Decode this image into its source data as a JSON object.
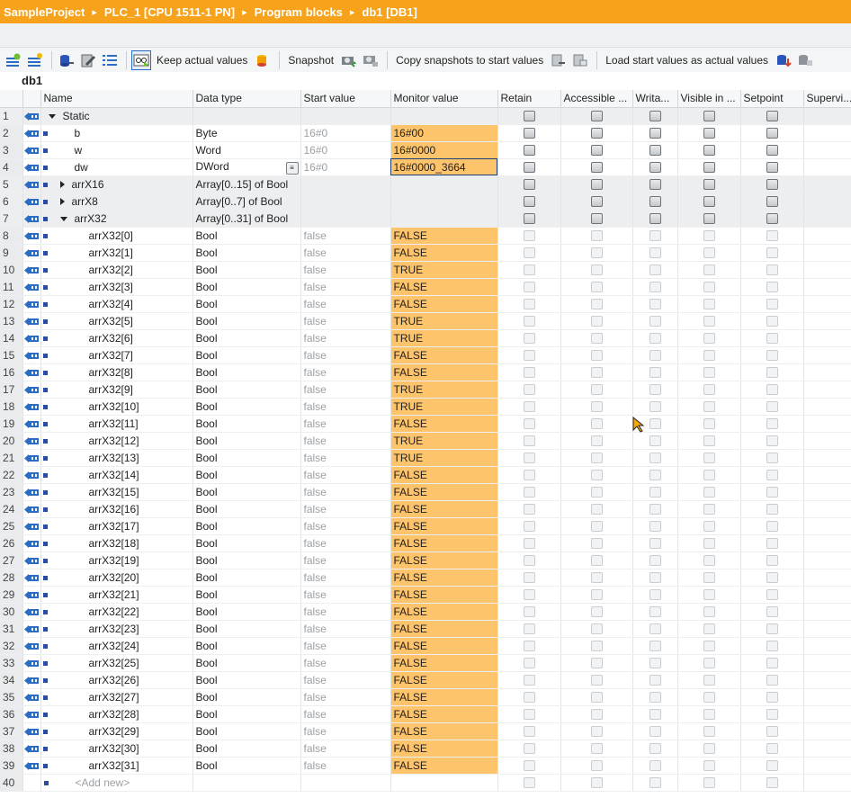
{
  "breadcrumb": [
    "SampleProject",
    "PLC_1 [CPU 1511-1 PN]",
    "Program blocks",
    "db1 [DB1]"
  ],
  "toolbar": {
    "keep_actual": "Keep actual values",
    "snapshot": "Snapshot",
    "copy_snapshots": "Copy snapshots to start values",
    "load_start": "Load start values as actual values"
  },
  "block_title": "db1",
  "columns": [
    "Name",
    "Data type",
    "Start value",
    "Monitor value",
    "Retain",
    "Accessible ...",
    "Writa...",
    "Visible in ...",
    "Setpoint",
    "Supervi..."
  ],
  "rows": [
    {
      "n": "1",
      "name": "Static",
      "type": "",
      "start": "",
      "mon": "",
      "level": 0,
      "exp": "down"
    },
    {
      "n": "2",
      "name": "b",
      "type": "Byte",
      "start": "16#0",
      "mon": "16#00",
      "level": 1
    },
    {
      "n": "3",
      "name": "w",
      "type": "Word",
      "start": "16#0",
      "mon": "16#0000",
      "level": 1
    },
    {
      "n": "4",
      "name": "dw",
      "type": "DWord",
      "start": "16#0",
      "mon": "16#0000_3664",
      "level": 1,
      "sel": true
    },
    {
      "n": "5",
      "name": "arrX16",
      "type": "Array[0..15] of Bool",
      "start": "",
      "mon": "",
      "level": 1,
      "exp": "right"
    },
    {
      "n": "6",
      "name": "arrX8",
      "type": "Array[0..7] of Bool",
      "start": "",
      "mon": "",
      "level": 1,
      "exp": "right"
    },
    {
      "n": "7",
      "name": "arrX32",
      "type": "Array[0..31] of Bool",
      "start": "",
      "mon": "",
      "level": 1,
      "exp": "down"
    },
    {
      "n": "8",
      "name": "arrX32[0]",
      "type": "Bool",
      "start": "false",
      "mon": "FALSE",
      "level": 2
    },
    {
      "n": "9",
      "name": "arrX32[1]",
      "type": "Bool",
      "start": "false",
      "mon": "FALSE",
      "level": 2
    },
    {
      "n": "10",
      "name": "arrX32[2]",
      "type": "Bool",
      "start": "false",
      "mon": "TRUE",
      "level": 2
    },
    {
      "n": "11",
      "name": "arrX32[3]",
      "type": "Bool",
      "start": "false",
      "mon": "FALSE",
      "level": 2
    },
    {
      "n": "12",
      "name": "arrX32[4]",
      "type": "Bool",
      "start": "false",
      "mon": "FALSE",
      "level": 2
    },
    {
      "n": "13",
      "name": "arrX32[5]",
      "type": "Bool",
      "start": "false",
      "mon": "TRUE",
      "level": 2
    },
    {
      "n": "14",
      "name": "arrX32[6]",
      "type": "Bool",
      "start": "false",
      "mon": "TRUE",
      "level": 2
    },
    {
      "n": "15",
      "name": "arrX32[7]",
      "type": "Bool",
      "start": "false",
      "mon": "FALSE",
      "level": 2
    },
    {
      "n": "16",
      "name": "arrX32[8]",
      "type": "Bool",
      "start": "false",
      "mon": "FALSE",
      "level": 2
    },
    {
      "n": "17",
      "name": "arrX32[9]",
      "type": "Bool",
      "start": "false",
      "mon": "TRUE",
      "level": 2
    },
    {
      "n": "18",
      "name": "arrX32[10]",
      "type": "Bool",
      "start": "false",
      "mon": "TRUE",
      "level": 2
    },
    {
      "n": "19",
      "name": "arrX32[11]",
      "type": "Bool",
      "start": "false",
      "mon": "FALSE",
      "level": 2
    },
    {
      "n": "20",
      "name": "arrX32[12]",
      "type": "Bool",
      "start": "false",
      "mon": "TRUE",
      "level": 2
    },
    {
      "n": "21",
      "name": "arrX32[13]",
      "type": "Bool",
      "start": "false",
      "mon": "TRUE",
      "level": 2
    },
    {
      "n": "22",
      "name": "arrX32[14]",
      "type": "Bool",
      "start": "false",
      "mon": "FALSE",
      "level": 2
    },
    {
      "n": "23",
      "name": "arrX32[15]",
      "type": "Bool",
      "start": "false",
      "mon": "FALSE",
      "level": 2
    },
    {
      "n": "24",
      "name": "arrX32[16]",
      "type": "Bool",
      "start": "false",
      "mon": "FALSE",
      "level": 2
    },
    {
      "n": "25",
      "name": "arrX32[17]",
      "type": "Bool",
      "start": "false",
      "mon": "FALSE",
      "level": 2
    },
    {
      "n": "26",
      "name": "arrX32[18]",
      "type": "Bool",
      "start": "false",
      "mon": "FALSE",
      "level": 2
    },
    {
      "n": "27",
      "name": "arrX32[19]",
      "type": "Bool",
      "start": "false",
      "mon": "FALSE",
      "level": 2
    },
    {
      "n": "28",
      "name": "arrX32[20]",
      "type": "Bool",
      "start": "false",
      "mon": "FALSE",
      "level": 2
    },
    {
      "n": "29",
      "name": "arrX32[21]",
      "type": "Bool",
      "start": "false",
      "mon": "FALSE",
      "level": 2
    },
    {
      "n": "30",
      "name": "arrX32[22]",
      "type": "Bool",
      "start": "false",
      "mon": "FALSE",
      "level": 2
    },
    {
      "n": "31",
      "name": "arrX32[23]",
      "type": "Bool",
      "start": "false",
      "mon": "FALSE",
      "level": 2
    },
    {
      "n": "32",
      "name": "arrX32[24]",
      "type": "Bool",
      "start": "false",
      "mon": "FALSE",
      "level": 2
    },
    {
      "n": "33",
      "name": "arrX32[25]",
      "type": "Bool",
      "start": "false",
      "mon": "FALSE",
      "level": 2
    },
    {
      "n": "34",
      "name": "arrX32[26]",
      "type": "Bool",
      "start": "false",
      "mon": "FALSE",
      "level": 2
    },
    {
      "n": "35",
      "name": "arrX32[27]",
      "type": "Bool",
      "start": "false",
      "mon": "FALSE",
      "level": 2
    },
    {
      "n": "36",
      "name": "arrX32[28]",
      "type": "Bool",
      "start": "false",
      "mon": "FALSE",
      "level": 2
    },
    {
      "n": "37",
      "name": "arrX32[29]",
      "type": "Bool",
      "start": "false",
      "mon": "FALSE",
      "level": 2
    },
    {
      "n": "38",
      "name": "arrX32[30]",
      "type": "Bool",
      "start": "false",
      "mon": "FALSE",
      "level": 2
    },
    {
      "n": "39",
      "name": "arrX32[31]",
      "type": "Bool",
      "start": "false",
      "mon": "FALSE",
      "level": 2
    }
  ],
  "add_new": {
    "n": "40",
    "label": "<Add new>"
  },
  "colors": {
    "header": "#f7a21b",
    "monitor": "#fec46b",
    "interface": "#2b6cc4"
  }
}
